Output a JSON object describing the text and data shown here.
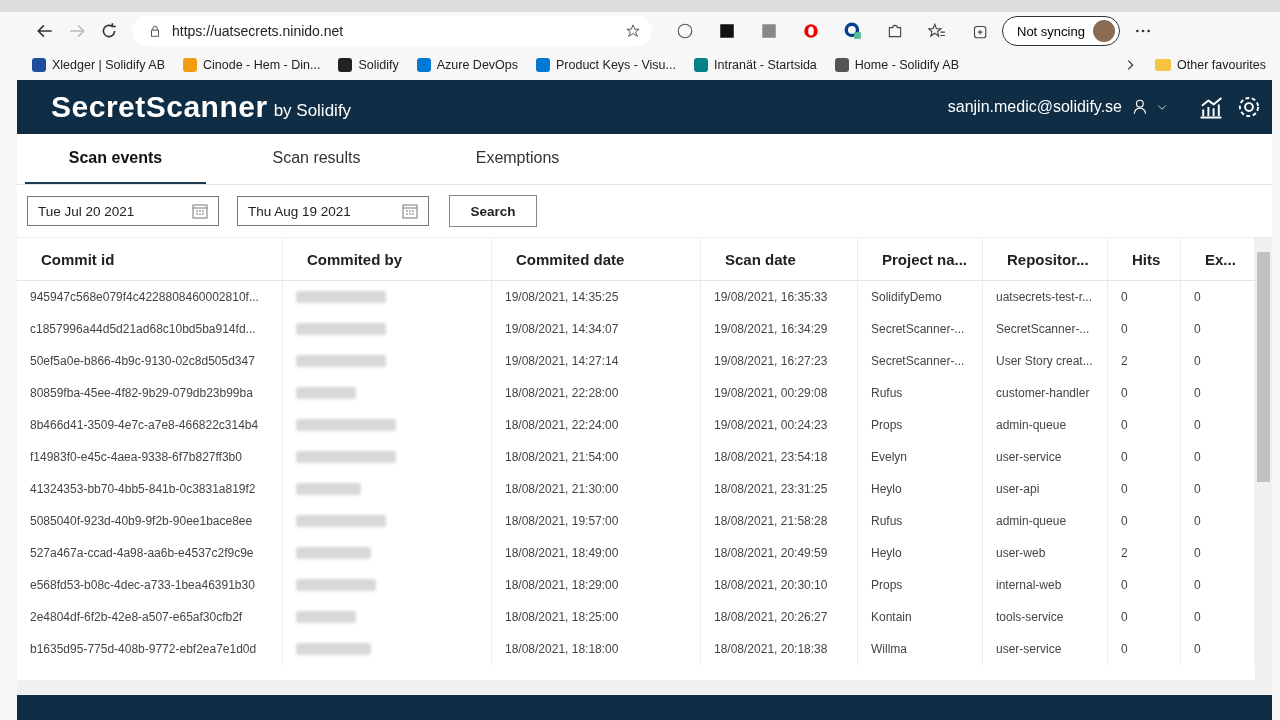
{
  "browser": {
    "url": "https://uatsecrets.ninido.net",
    "profile_button": "Not syncing",
    "bookmarks": [
      {
        "label": "Xledger | Solidify AB",
        "color": "#1f4e9c"
      },
      {
        "label": "Cinode - Hem - Din...",
        "color": "#f39c12"
      },
      {
        "label": "Solidify",
        "color": "#222222"
      },
      {
        "label": "Azure DevOps",
        "color": "#0078d4"
      },
      {
        "label": "Product Keys - Visu...",
        "color": "#0078d4"
      },
      {
        "label": "Intranät - Startsida",
        "color": "#038387"
      },
      {
        "label": "Home - Solidify AB",
        "color": "#555555"
      }
    ],
    "other_favourites": "Other favourites"
  },
  "app": {
    "title": "SecretScanner",
    "subtitle": "by Solidify",
    "user": "sanjin.medic@solidify.se"
  },
  "tabs": [
    {
      "label": "Scan events",
      "selected": true
    },
    {
      "label": "Scan results",
      "selected": false
    },
    {
      "label": "Exemptions",
      "selected": false
    }
  ],
  "filters": {
    "from": "Tue Jul 20 2021",
    "to": "Thu Aug 19 2021",
    "button": "Search"
  },
  "table": {
    "columns": [
      "Commit id",
      "Commited by",
      "Commited date",
      "Scan date",
      "Project na...",
      "Repositor...",
      "Hits",
      "Ex..."
    ],
    "rows": [
      {
        "commit": "945947c568e079f4c4228808460002810f...",
        "committed": "19/08/2021, 14:35:25",
        "scanned": "19/08/2021, 16:35:33",
        "project": "SolidifyDemo",
        "repo": "uatsecrets-test-r...",
        "hits": "0",
        "ex": "0"
      },
      {
        "commit": "c1857996a44d5d21ad68c10bd5ba914fd...",
        "committed": "19/08/2021, 14:34:07",
        "scanned": "19/08/2021, 16:34:29",
        "project": "SecretScanner-...",
        "repo": "SecretScanner-...",
        "hits": "0",
        "ex": "0"
      },
      {
        "commit": "50ef5a0e-b866-4b9c-9130-02c8d505d347",
        "committed": "19/08/2021, 14:27:14",
        "scanned": "19/08/2021, 16:27:23",
        "project": "SecretScanner-...",
        "repo": "User Story creat...",
        "hits": "2",
        "ex": "0"
      },
      {
        "commit": "80859fba-45ee-4f82-9b29-079db23b99ba",
        "committed": "18/08/2021, 22:28:00",
        "scanned": "19/08/2021, 00:29:08",
        "project": "Rufus",
        "repo": "customer-handler",
        "hits": "0",
        "ex": "0"
      },
      {
        "commit": "8b466d41-3509-4e7c-a7e8-466822c314b4",
        "committed": "18/08/2021, 22:24:00",
        "scanned": "19/08/2021, 00:24:23",
        "project": "Props",
        "repo": "admin-queue",
        "hits": "0",
        "ex": "0"
      },
      {
        "commit": "f14983f0-e45c-4aea-9338-6f7b827ff3b0",
        "committed": "18/08/2021, 21:54:00",
        "scanned": "18/08/2021, 23:54:18",
        "project": "Evelyn",
        "repo": "user-service",
        "hits": "0",
        "ex": "0"
      },
      {
        "commit": "41324353-bb70-4bb5-841b-0c3831a819f2",
        "committed": "18/08/2021, 21:30:00",
        "scanned": "18/08/2021, 23:31:25",
        "project": "Heylo",
        "repo": "user-api",
        "hits": "0",
        "ex": "0"
      },
      {
        "commit": "5085040f-923d-40b9-9f2b-90ee1bace8ee",
        "committed": "18/08/2021, 19:57:00",
        "scanned": "18/08/2021, 21:58:28",
        "project": "Rufus",
        "repo": "admin-queue",
        "hits": "0",
        "ex": "0"
      },
      {
        "commit": "527a467a-ccad-4a98-aa6b-e4537c2f9c9e",
        "committed": "18/08/2021, 18:49:00",
        "scanned": "18/08/2021, 20:49:59",
        "project": "Heylo",
        "repo": "user-web",
        "hits": "2",
        "ex": "0"
      },
      {
        "commit": "e568fd53-b08c-4dec-a733-1bea46391b30",
        "committed": "18/08/2021, 18:29:00",
        "scanned": "18/08/2021, 20:30:10",
        "project": "Props",
        "repo": "internal-web",
        "hits": "0",
        "ex": "0"
      },
      {
        "commit": "2e4804df-6f2b-42e8-a507-e65af30cfb2f",
        "committed": "18/08/2021, 18:25:00",
        "scanned": "18/08/2021, 20:26:27",
        "project": "Kontain",
        "repo": "tools-service",
        "hits": "0",
        "ex": "0"
      },
      {
        "commit": "b1635d95-775d-408b-9772-ebf2ea7e1d0d",
        "committed": "18/08/2021, 18:18:00",
        "scanned": "18/08/2021, 20:18:38",
        "project": "Willma",
        "repo": "user-service",
        "hits": "0",
        "ex": "0"
      }
    ]
  }
}
